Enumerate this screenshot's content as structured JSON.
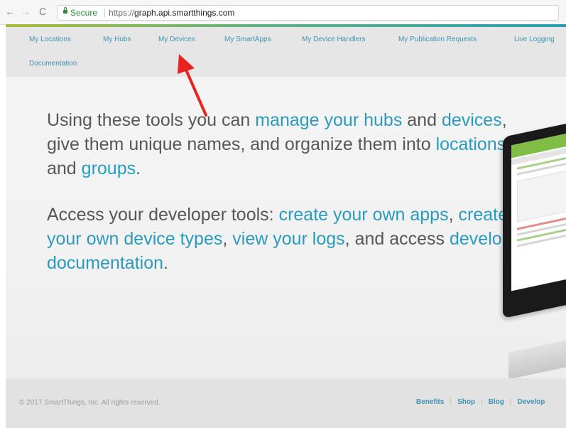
{
  "browser": {
    "back": "←",
    "forward": "→",
    "reload": "C",
    "secure_label": "Secure",
    "url_protocol": "https://",
    "url_host": "graph.api.smartthings.com"
  },
  "nav": [
    {
      "label": "My Locations"
    },
    {
      "label": "My Hubs"
    },
    {
      "label": "My Devices"
    },
    {
      "label": "My SmartApps"
    },
    {
      "label": "My Device Handlers"
    },
    {
      "label": "My Publication Requests"
    },
    {
      "label": "Live Logging"
    },
    {
      "label": "Documentation"
    }
  ],
  "hero": {
    "p1": {
      "t1": "Using these tools you can ",
      "l1": "manage your hubs",
      "t2": " and ",
      "l2": "devices",
      "t3": ", give them unique names, and organize them into ",
      "l3": "locations",
      "t4": " and ",
      "l4": "groups",
      "t5": "."
    },
    "p2": {
      "t1": "Access your developer tools: ",
      "l1": "create your own apps",
      "t2": ", ",
      "l2": "create your own device types",
      "t3": ", ",
      "l3": "view your logs",
      "t4": ", and access ",
      "l4": "developer documentation",
      "t5": "."
    }
  },
  "footer": {
    "copyright": "© 2017 SmartThings, Inc. All rights reserved.",
    "links": [
      "Benefits",
      "Shop",
      "Blog",
      "Develop"
    ]
  },
  "colors": {
    "link": "#2b9bbd",
    "nav_link": "#3f93b3",
    "secure": "#2e8b3a",
    "annotation_arrow": "#e8231f"
  }
}
